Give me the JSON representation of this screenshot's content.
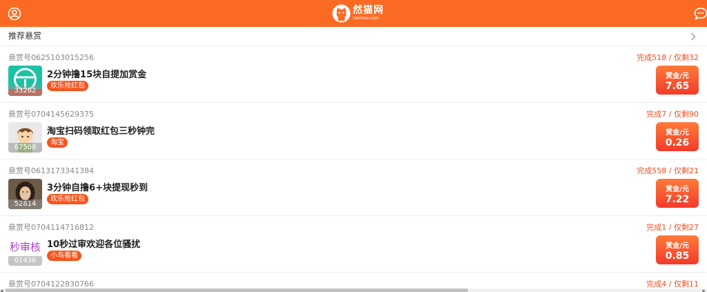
{
  "header": {
    "logo_cn": "然猫网",
    "logo_en": "ranmao.com",
    "user_icon": "user-circle-icon",
    "chat_icon": "chat-bubble-icon",
    "brand_color": "#fb6a22"
  },
  "section": {
    "title": "推荐悬赏"
  },
  "tasks": [
    {
      "id": "悬赏号0625103015256",
      "progress": "完成518 / 仅剩32",
      "title": "2分钟撸15块自提加赏金",
      "tag": "欢乐抢红包",
      "count": "33262",
      "reward_label": "赏金/元",
      "reward": "7.65",
      "thumb": "steering-wheel-icon"
    },
    {
      "id": "悬赏号0704145629375",
      "progress": "完成7 / 仅剩90",
      "title": "淘宝扫码领取红包三秒钟完",
      "tag": "淘宝",
      "count": "67508",
      "reward_label": "赏金/元",
      "reward": "0.26",
      "thumb": "cartoon-avatar-icon"
    },
    {
      "id": "悬赏号0613173341384",
      "progress": "完成558 / 仅剩21",
      "title": "3分钟自撸6+块提现秒到",
      "tag": "欢乐抢红包",
      "count": "52814",
      "reward_label": "赏金/元",
      "reward": "7.22",
      "thumb": "girl-photo-avatar"
    },
    {
      "id": "悬赏号0704114716812",
      "progress": "完成1 / 仅剩27",
      "title": "10秒过审欢迎各位骚扰",
      "tag": "小鸟看看",
      "count": "61436",
      "reward_label": "赏金/元",
      "reward": "0.85",
      "thumb_text": "秒审核"
    },
    {
      "id": "悬赏号0704122830766",
      "progress": "完成4 / 仅剩11"
    }
  ]
}
